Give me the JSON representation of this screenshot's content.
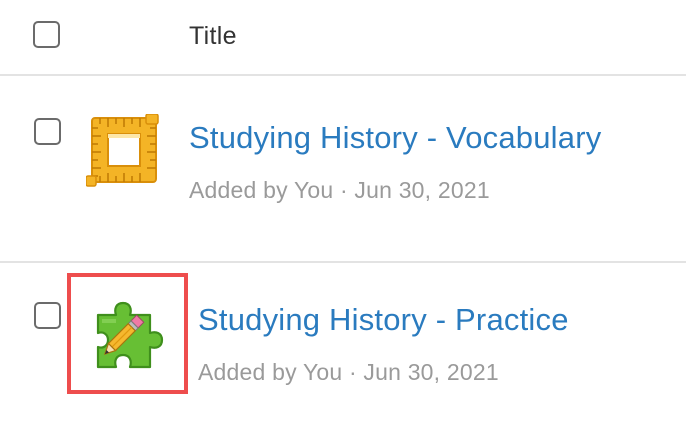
{
  "header": {
    "title_label": "Title"
  },
  "items": [
    {
      "title": "Studying History - Vocabulary",
      "meta": "Added by You · Jun 30, 2021",
      "icon": "ruler-square-icon",
      "icon_color": "#f2a91c"
    },
    {
      "title": "Studying History - Practice",
      "meta": "Added by You · Jun 30, 2021",
      "icon": "puzzle-pencil-icon",
      "icon_color": "#5cb531",
      "highlighted": true,
      "highlight_color": "#ee4d4d"
    }
  ]
}
